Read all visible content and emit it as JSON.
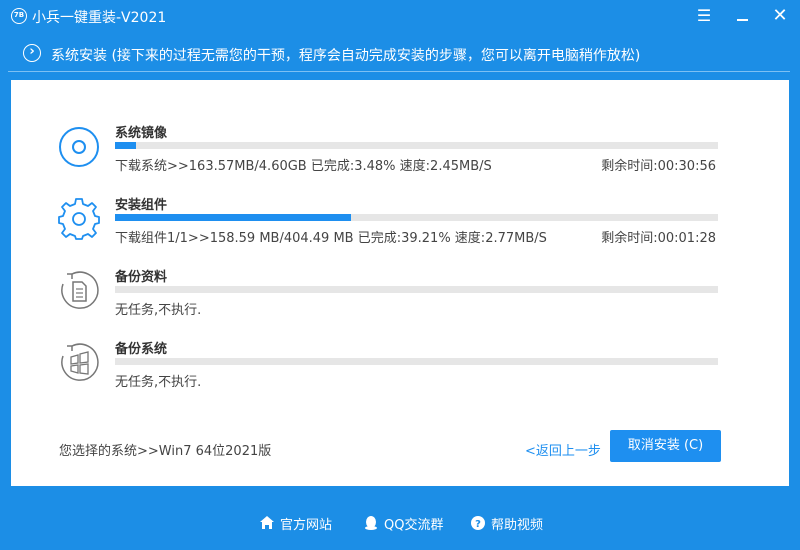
{
  "window": {
    "logo_text": "7B",
    "title": "小兵一键重装-V2021",
    "menu_icon": "menu-icon",
    "close_icon": "close-icon"
  },
  "stepbar": {
    "icon": "chevron-right-icon",
    "text": "系统安装 (接下来的过程无需您的干预，程序会自动完成安装的步骤，您可以离开电脑稍作放松)"
  },
  "tasks": [
    {
      "icon": "disc-icon",
      "name": "系统镜像",
      "progress": 0.0348,
      "status": "下载系统>>163.57MB/4.60GB 已完成:3.48%   速度:2.45MB/S",
      "remaining": "剩余时间:00:30:56"
    },
    {
      "icon": "gear-icon",
      "name": "安装组件",
      "progress": 0.3921,
      "status": "下载组件1/1>>158.59 MB/404.49 MB 已完成:39.21%   速度:2.77MB/S",
      "remaining": "剩余时间:00:01:28"
    },
    {
      "icon": "document-icon",
      "name": "备份资料",
      "progress": 0,
      "status": "无任务,不执行.",
      "remaining": ""
    },
    {
      "icon": "windows-icon",
      "name": "备份系统",
      "progress": 0,
      "status": "无任务,不执行.",
      "remaining": ""
    }
  ],
  "selected_system": "您选择的系统>>Win7 64位2021版",
  "back_link": "<返回上一步",
  "cancel_button": "取消安装 (C)",
  "footer": [
    {
      "icon": "home-icon",
      "label": "官方网站"
    },
    {
      "icon": "qq-icon",
      "label": "QQ交流群"
    },
    {
      "icon": "help-icon",
      "label": "帮助视频"
    }
  ],
  "colors": {
    "background": "#1c8ee6",
    "accent": "#1e8ff0",
    "track": "#e6e6e6"
  }
}
